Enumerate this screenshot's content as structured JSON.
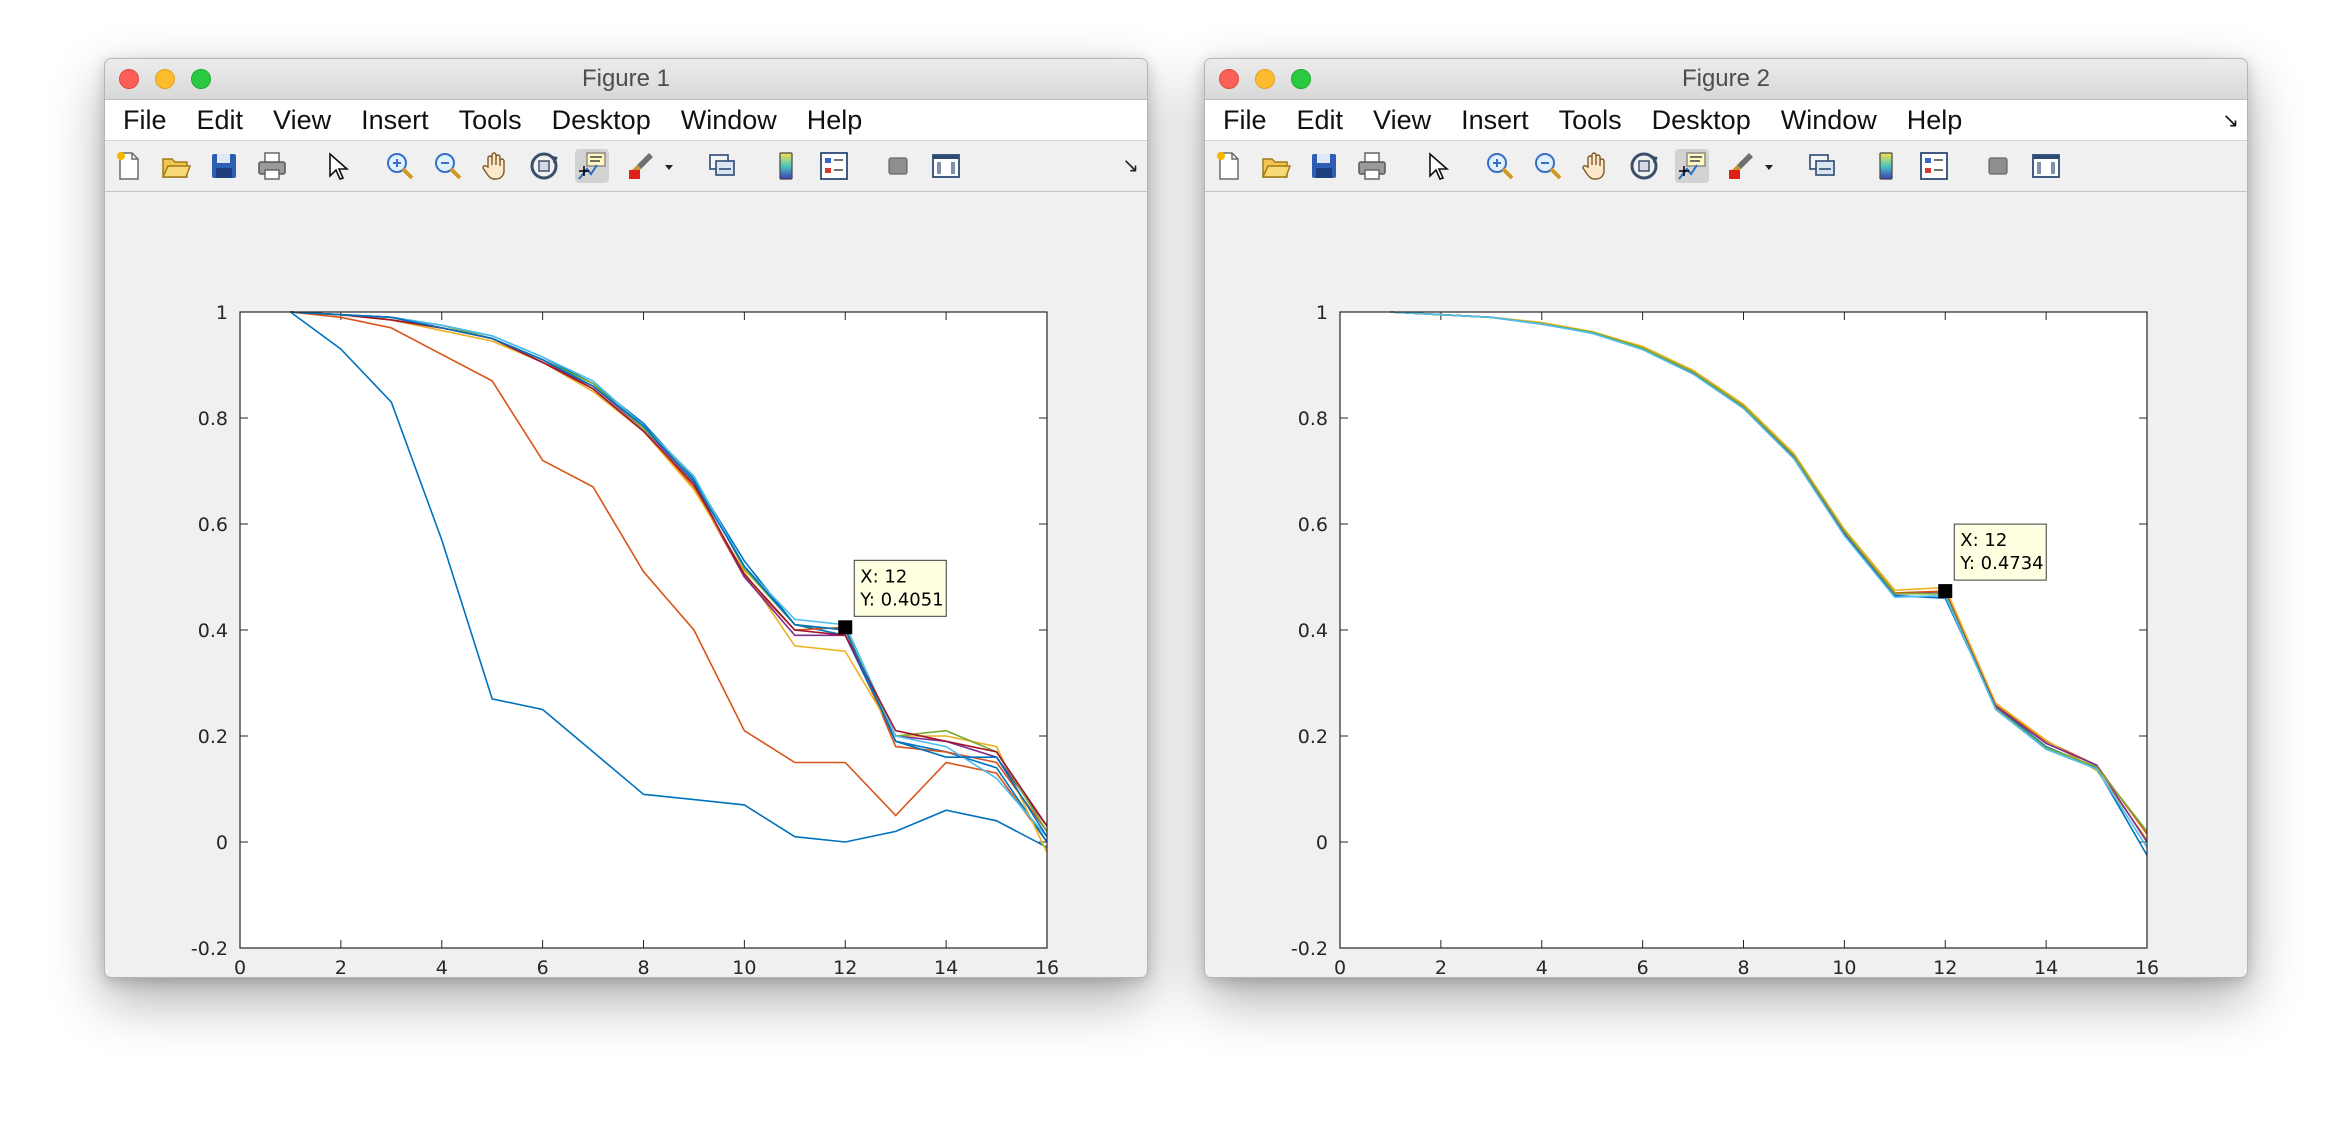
{
  "figures": [
    {
      "title": "Figure 1",
      "menu": [
        "File",
        "Edit",
        "View",
        "Insert",
        "Tools",
        "Desktop",
        "Window",
        "Help"
      ],
      "toolbar_icons": [
        "new-figure-icon",
        "open-file-icon",
        "save-icon",
        "print-icon",
        "edit-plot-arrow-icon",
        "zoom-in-icon",
        "zoom-out-icon",
        "pan-hand-icon",
        "rotate-3d-icon",
        "data-cursor-icon",
        "brush-icon",
        "brush-dropdown-icon",
        "link-plot-icon",
        "colorbar-icon",
        "legend-icon",
        "hide-plot-tools-icon",
        "show-plot-tools-icon"
      ],
      "corner_glyph": "↘",
      "datatip": {
        "x_label": "X: 12",
        "y_label": "Y: 0.4051",
        "x": 12,
        "y": 0.4051
      },
      "chart_data": {
        "type": "line",
        "title": "",
        "xlabel": "",
        "ylabel": "",
        "xlim": [
          0,
          16
        ],
        "ylim": [
          -0.2,
          1
        ],
        "xticks": [
          "0",
          "2",
          "4",
          "6",
          "8",
          "10",
          "12",
          "14",
          "16"
        ],
        "yticks": [
          "-0.2",
          "0",
          "0.2",
          "0.4",
          "0.6",
          "0.8",
          "1"
        ],
        "x": [
          1,
          2,
          3,
          4,
          5,
          6,
          7,
          8,
          9,
          10,
          11,
          12,
          13,
          14,
          15,
          16
        ],
        "series": [
          {
            "color": "#0072BD",
            "values": [
              1,
              0.93,
              0.83,
              0.57,
              0.27,
              0.25,
              0.17,
              0.09,
              0.08,
              0.07,
              0.01,
              0.0,
              0.02,
              0.06,
              0.04,
              -0.01
            ]
          },
          {
            "color": "#D95319",
            "values": [
              1,
              0.99,
              0.97,
              0.92,
              0.87,
              0.72,
              0.67,
              0.51,
              0.4,
              0.21,
              0.15,
              0.15,
              0.05,
              0.15,
              0.13,
              0.0
            ]
          },
          {
            "color": "#0072BD",
            "values": [
              1,
              0.995,
              0.99,
              0.975,
              0.955,
              0.915,
              0.865,
              0.79,
              0.685,
              0.53,
              0.41,
              0.39,
              0.19,
              0.17,
              0.14,
              0.0
            ]
          },
          {
            "color": "#D95319",
            "values": [
              1,
              0.995,
              0.985,
              0.97,
              0.95,
              0.91,
              0.855,
              0.775,
              0.67,
              0.5,
              0.4,
              0.405,
              0.18,
              0.17,
              0.15,
              0.02
            ]
          },
          {
            "color": "#EDB120",
            "values": [
              1,
              0.995,
              0.985,
              0.965,
              0.945,
              0.905,
              0.85,
              0.775,
              0.665,
              0.51,
              0.37,
              0.36,
              0.2,
              0.2,
              0.18,
              -0.02
            ]
          },
          {
            "color": "#7E2F8E",
            "values": [
              1,
              0.995,
              0.99,
              0.97,
              0.95,
              0.905,
              0.86,
              0.78,
              0.68,
              0.5,
              0.39,
              0.39,
              0.2,
              0.19,
              0.16,
              0.03
            ]
          },
          {
            "color": "#77AC30",
            "values": [
              1,
              0.995,
              0.99,
              0.975,
              0.95,
              0.91,
              0.865,
              0.78,
              0.69,
              0.515,
              0.41,
              0.4,
              0.2,
              0.21,
              0.17,
              0.02
            ]
          },
          {
            "color": "#4DBEEE",
            "values": [
              1,
              0.995,
              0.99,
              0.975,
              0.955,
              0.915,
              0.87,
              0.785,
              0.69,
              0.52,
              0.42,
              0.41,
              0.2,
              0.18,
              0.12,
              0.01
            ]
          },
          {
            "color": "#A2142F",
            "values": [
              1,
              0.995,
              0.985,
              0.97,
              0.95,
              0.905,
              0.855,
              0.775,
              0.675,
              0.505,
              0.4,
              0.39,
              0.21,
              0.19,
              0.17,
              0.03
            ]
          },
          {
            "color": "#0072BD",
            "values": [
              1,
              0.995,
              0.99,
              0.97,
              0.95,
              0.91,
              0.86,
              0.785,
              0.68,
              0.52,
              0.41,
              0.4,
              0.19,
              0.16,
              0.16,
              0.01
            ]
          }
        ]
      }
    },
    {
      "title": "Figure 2",
      "menu": [
        "File",
        "Edit",
        "View",
        "Insert",
        "Tools",
        "Desktop",
        "Window",
        "Help"
      ],
      "toolbar_icons": [
        "new-figure-icon",
        "open-file-icon",
        "save-icon",
        "print-icon",
        "edit-plot-arrow-icon",
        "zoom-in-icon",
        "zoom-out-icon",
        "pan-hand-icon",
        "rotate-3d-icon",
        "data-cursor-icon",
        "brush-icon",
        "brush-dropdown-icon",
        "link-plot-icon",
        "colorbar-icon",
        "legend-icon",
        "hide-plot-tools-icon",
        "show-plot-tools-icon"
      ],
      "corner_glyph": "↘",
      "datatip": {
        "x_label": "X: 12",
        "y_label": "Y: 0.4734",
        "x": 12,
        "y": 0.4734
      },
      "chart_data": {
        "type": "line",
        "title": "",
        "xlabel": "",
        "ylabel": "",
        "xlim": [
          0,
          16
        ],
        "ylim": [
          -0.2,
          1
        ],
        "xticks": [
          "0",
          "2",
          "4",
          "6",
          "8",
          "10",
          "12",
          "14",
          "16"
        ],
        "yticks": [
          "-0.2",
          "0",
          "0.2",
          "0.4",
          "0.6",
          "0.8",
          "1"
        ],
        "x": [
          1,
          2,
          3,
          4,
          5,
          6,
          7,
          8,
          9,
          10,
          11,
          12,
          13,
          14,
          15,
          16
        ],
        "series": [
          {
            "color": "#0072BD",
            "values": [
              1,
              0.995,
              0.99,
              0.978,
              0.96,
              0.93,
              0.885,
              0.82,
              0.725,
              0.58,
              0.465,
              0.46,
              0.255,
              0.18,
              0.14,
              -0.025
            ]
          },
          {
            "color": "#D95319",
            "values": [
              1,
              0.995,
              0.99,
              0.978,
              0.962,
              0.933,
              0.888,
              0.823,
              0.73,
              0.588,
              0.47,
              0.4734,
              0.258,
              0.19,
              0.145,
              0.015
            ]
          },
          {
            "color": "#EDB120",
            "values": [
              1,
              0.995,
              0.99,
              0.98,
              0.963,
              0.935,
              0.89,
              0.826,
              0.733,
              0.59,
              0.475,
              0.48,
              0.262,
              0.192,
              0.135,
              0.005
            ]
          },
          {
            "color": "#7E2F8E",
            "values": [
              1,
              0.995,
              0.99,
              0.977,
              0.961,
              0.931,
              0.886,
              0.821,
              0.727,
              0.584,
              0.468,
              0.47,
              0.256,
              0.186,
              0.145,
              0.0
            ]
          },
          {
            "color": "#77AC30",
            "values": [
              1,
              0.995,
              0.99,
              0.978,
              0.962,
              0.932,
              0.887,
              0.822,
              0.729,
              0.586,
              0.469,
              0.468,
              0.252,
              0.178,
              0.142,
              0.02
            ]
          },
          {
            "color": "#4DBEEE",
            "values": [
              1,
              0.995,
              0.99,
              0.977,
              0.96,
              0.929,
              0.883,
              0.818,
              0.723,
              0.578,
              0.462,
              0.465,
              0.25,
              0.175,
              0.138,
              -0.01
            ]
          }
        ]
      }
    }
  ]
}
